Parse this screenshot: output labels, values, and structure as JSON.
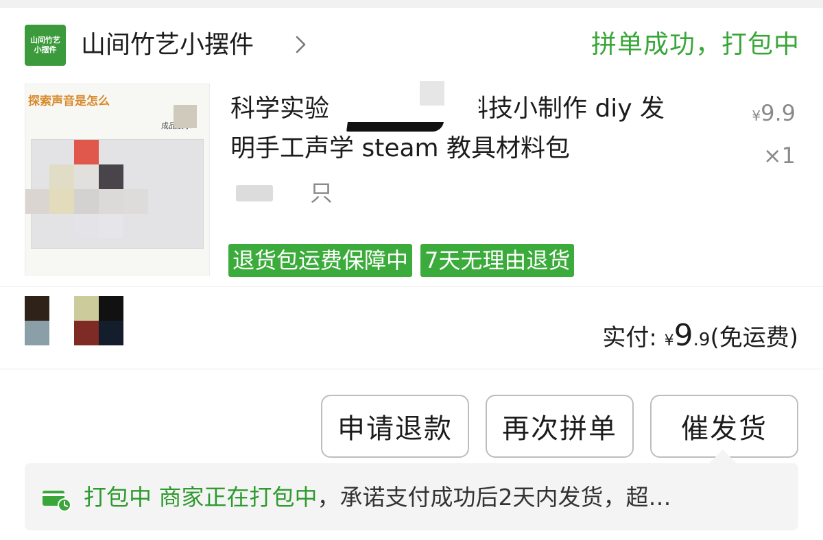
{
  "shop": {
    "logo_text": "山间竹艺小摆件",
    "name": "山间竹艺小摆件",
    "order_status": "拼单成功，打包中"
  },
  "product": {
    "image_caption": "探索声音是怎么",
    "image_subcaption": "成品展示",
    "title_line1": "科学实验",
    "title_line1_end": "科技小制作 diy 发",
    "title_line2": "明手工声学 steam 教具材料包",
    "spec_suffix": "只",
    "unit_price_symbol": "¥",
    "unit_price": "9.9",
    "quantity": "×1",
    "tags": [
      "退货包运费保障中",
      "7天无理由退货"
    ]
  },
  "payment": {
    "label": "实付:",
    "symbol": "¥",
    "amount_int": "9",
    "amount_dec": ".9",
    "note": "(免运费)"
  },
  "actions": {
    "refund": "申请退款",
    "regroup": "再次拼单",
    "urge_ship": "催发货"
  },
  "notice": {
    "status": "打包中",
    "highlight": "商家正在打包中",
    "text": "，承诺支付成功后2天内发货，超…"
  },
  "colors": {
    "accent_green": "#3aa63a",
    "tag_green": "#3bab3b",
    "muted_text": "#8a8a8a"
  },
  "icons": [
    "chevron-right-icon",
    "shipping-truck-icon"
  ]
}
